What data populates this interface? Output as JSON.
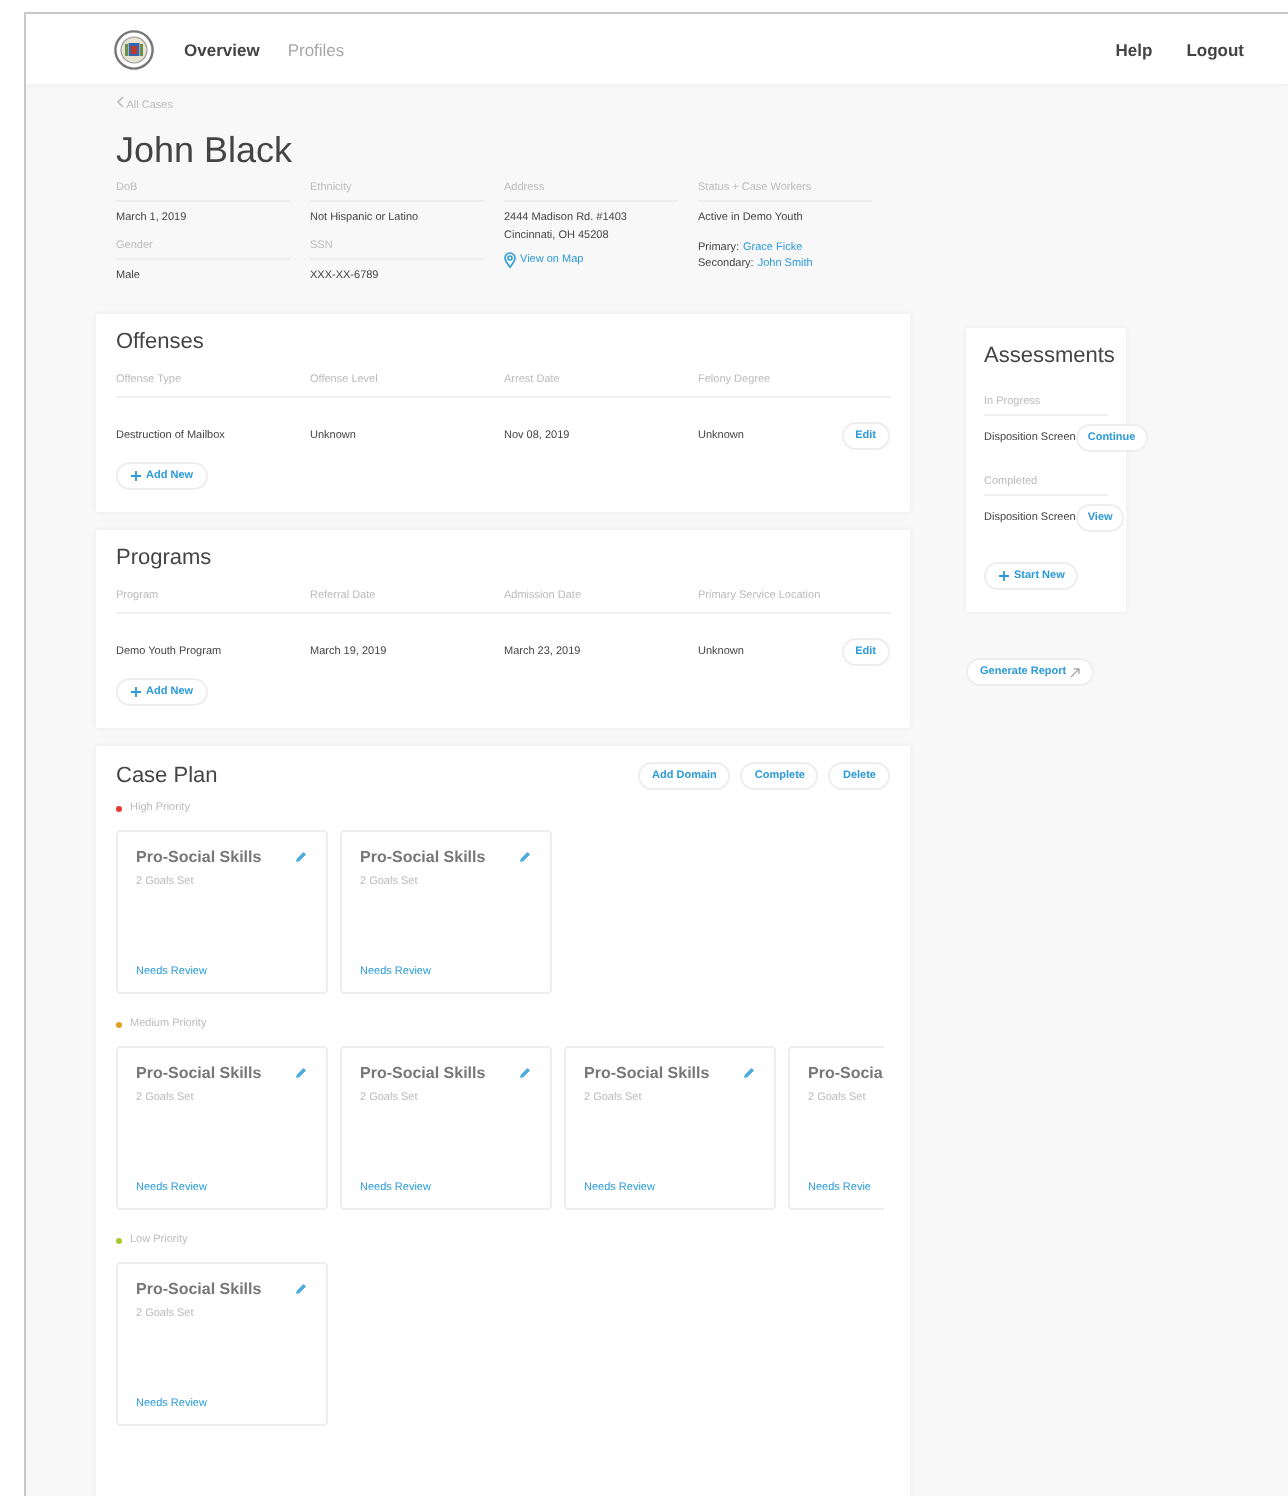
{
  "nav": {
    "items": [
      {
        "label": "Overview",
        "selected": true
      },
      {
        "label": "Profiles",
        "selected": false
      }
    ],
    "links": [
      "Help",
      "Logout"
    ]
  },
  "breadcrumb": "All Cases",
  "person": {
    "name": "John Black",
    "fields": [
      {
        "label": "DoB",
        "lines": [
          "March 1, 2019"
        ]
      },
      {
        "label": "Ethnicity",
        "lines": [
          "Not Hispanic or Latino"
        ]
      },
      {
        "label": "Address",
        "lines": [
          "2444 Madison Rd. #1403",
          "Cincinnati, OH 45208"
        ],
        "map_link": "View on Map"
      },
      {
        "label": "Status + Case Workers",
        "lines": [
          "Active in Demo Youth"
        ],
        "workers": [
          {
            "role": "Primary:",
            "name": "Grace Ficke"
          },
          {
            "role": "Secondary:",
            "name": "John Smith"
          }
        ]
      },
      {
        "label": "Gender",
        "lines": [
          "Male"
        ]
      },
      {
        "label": "SSN",
        "lines": [
          "XXX-XX-6789"
        ]
      }
    ]
  },
  "offenses": {
    "title": "Offenses",
    "columns": [
      "Offense Type",
      "Offense Level",
      "Arrest Date",
      "Felony Degree"
    ],
    "rows": [
      {
        "cells": [
          "Destruction of Mailbox",
          "Unknown",
          "Nov 08, 2019",
          "Unknown"
        ],
        "action": "Edit"
      }
    ],
    "add": "Add New"
  },
  "programs": {
    "title": "Programs",
    "columns": [
      "Program",
      "Referral Date",
      "Admission Date",
      "Primary Service Location"
    ],
    "rows": [
      {
        "cells": [
          "Demo Youth Program",
          "March 19, 2019",
          "March 23, 2019",
          "Unknown"
        ],
        "action": "Edit"
      }
    ],
    "add": "Add New"
  },
  "case_plan": {
    "title": "Case Plan",
    "actions": [
      "Add Domain",
      "Complete",
      "Delete"
    ],
    "groups": [
      {
        "label": "High Priority",
        "color": "#e53935",
        "cards": [
          {
            "title": "Pro-Social Skills",
            "goals": "2 Goals Set",
            "status": "Needs Review",
            "clipped": false
          },
          {
            "title": "Pro-Social Skills",
            "goals": "2 Goals Set",
            "status": "Needs Review",
            "clipped": false
          }
        ]
      },
      {
        "label": "Medium Priority",
        "color": "#e0a020",
        "cards": [
          {
            "title": "Pro-Social Skills",
            "goals": "2 Goals Set",
            "status": "Needs Review",
            "clipped": false
          },
          {
            "title": "Pro-Social Skills",
            "goals": "2 Goals Set",
            "status": "Needs Review",
            "clipped": false
          },
          {
            "title": "Pro-Social Skills",
            "goals": "2 Goals Set",
            "status": "Needs Review",
            "clipped": false
          },
          {
            "title": "Pro-Socia",
            "goals": "2 Goals Set",
            "status": "Needs Revie",
            "clipped": true
          }
        ]
      },
      {
        "label": "Low Priority",
        "color": "#a8c832",
        "cards": [
          {
            "title": "Pro-Social Skills",
            "goals": "2 Goals Set",
            "status": "Needs Review",
            "clipped": false
          }
        ]
      }
    ]
  },
  "assessments": {
    "title": "Assessments",
    "sections": [
      {
        "label": "In Progress",
        "items": [
          {
            "name": "Disposition Screen",
            "action": "Continue"
          }
        ]
      },
      {
        "label": "Completed",
        "items": [
          {
            "name": "Disposition Screen",
            "action": "View"
          }
        ]
      }
    ],
    "add": "Start New"
  },
  "report_button": "Generate Report"
}
